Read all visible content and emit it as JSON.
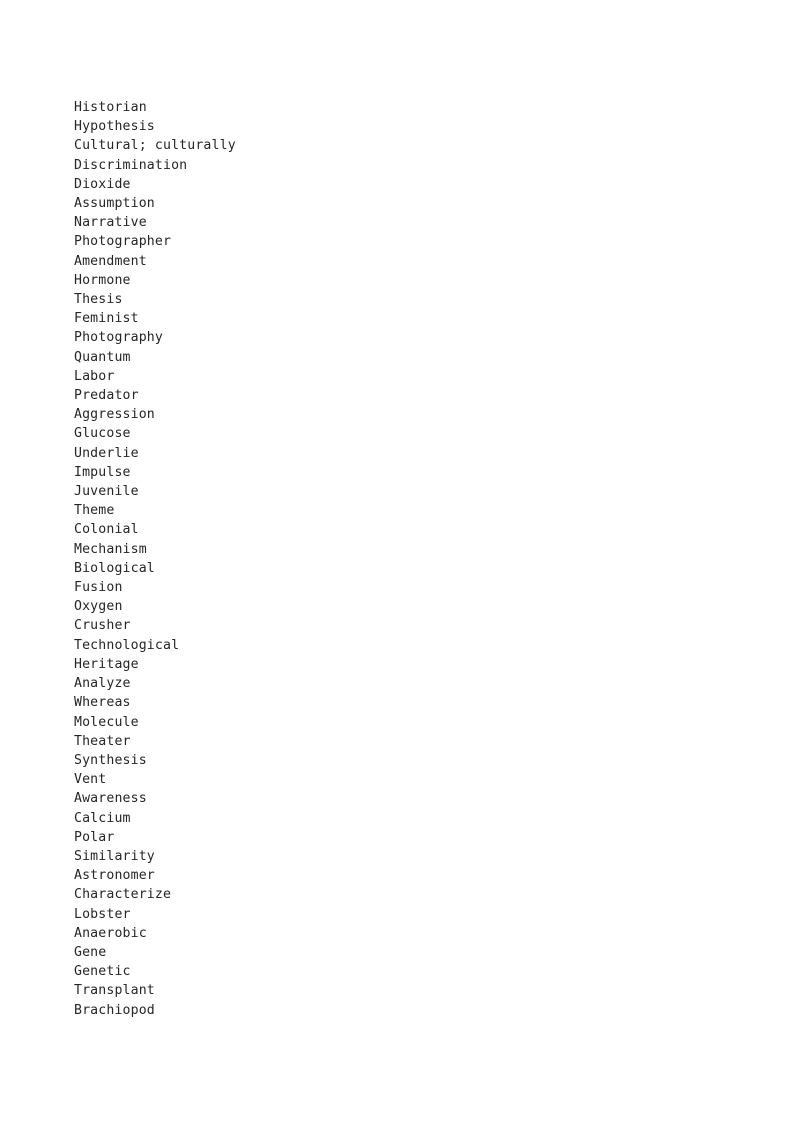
{
  "document": {
    "type": "word-list",
    "page_background": "#ffffff",
    "text_color": "#262626",
    "words": [
      "Historian",
      "Hypothesis",
      "Cultural; culturally",
      "Discrimination",
      "Dioxide",
      "Assumption",
      "Narrative",
      "Photographer",
      "Amendment",
      "Hormone",
      "Thesis",
      "Feminist",
      "Photography",
      "Quantum",
      "Labor",
      "Predator",
      "Aggression",
      "Glucose",
      "Underlie",
      "Impulse",
      "Juvenile",
      "Theme",
      "Colonial",
      "Mechanism",
      "Biological",
      "Fusion",
      "Oxygen",
      "Crusher",
      "Technological",
      "Heritage",
      "Analyze",
      "Whereas",
      "Molecule",
      "Theater",
      "Synthesis",
      "Vent",
      "Awareness",
      "Calcium",
      "Polar",
      "Similarity",
      "Astronomer",
      "Characterize",
      "Lobster",
      "Anaerobic",
      "Gene",
      "Genetic",
      "Transplant",
      "Brachiopod"
    ]
  }
}
